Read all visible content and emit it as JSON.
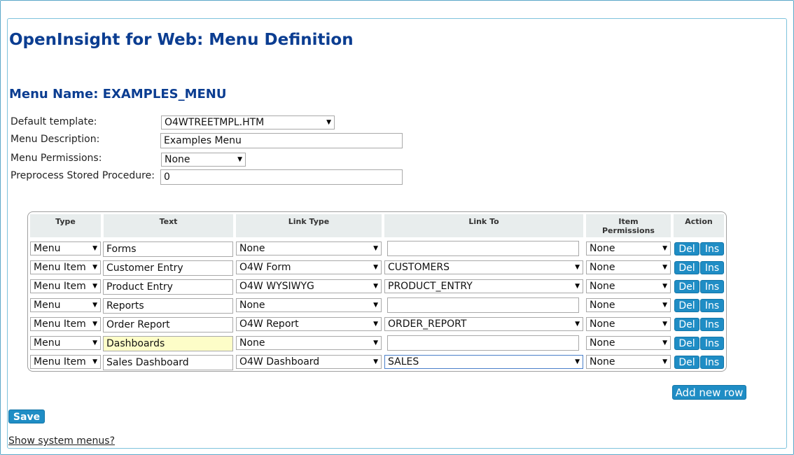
{
  "title": "OpenInsight for Web: Menu Definition",
  "menu_name": "Menu Name: EXAMPLES_MENU",
  "form": {
    "default_template_label": "Default template:",
    "default_template_value": "O4WTREETMPL.HTM",
    "description_label": "Menu Description:",
    "description_value": "Examples Menu",
    "permissions_label": "Menu Permissions:",
    "permissions_value": "None",
    "preprocess_label": "Preprocess Stored Procedure:",
    "preprocess_value": "0"
  },
  "table": {
    "headers": {
      "type": "Type",
      "text": "Text",
      "link_type": "Link Type",
      "link_to": "Link To",
      "item_permissions_1": "Item",
      "item_permissions_2": "Permissions",
      "action": "Action"
    },
    "rows": [
      {
        "type": "Menu",
        "text": "Forms",
        "link_type": "None",
        "link_to": "",
        "permissions": "None"
      },
      {
        "type": "Menu Item",
        "text": "Customer Entry",
        "link_type": "O4W Form",
        "link_to": "CUSTOMERS",
        "permissions": "None"
      },
      {
        "type": "Menu Item",
        "text": "Product Entry",
        "link_type": "O4W WYSIWYG",
        "link_to": "PRODUCT_ENTRY",
        "permissions": "None"
      },
      {
        "type": "Menu",
        "text": "Reports",
        "link_type": "None",
        "link_to": "",
        "permissions": "None"
      },
      {
        "type": "Menu Item",
        "text": "Order Report",
        "link_type": "O4W Report",
        "link_to": "ORDER_REPORT",
        "permissions": "None"
      },
      {
        "type": "Menu",
        "text": "Dashboards",
        "link_type": "None",
        "link_to": "",
        "permissions": "None"
      },
      {
        "type": "Menu Item",
        "text": "Sales Dashboard",
        "link_type": "O4W Dashboard",
        "link_to": "SALES",
        "permissions": "None"
      }
    ],
    "del_label": "Del",
    "ins_label": "Ins"
  },
  "add_row_label": "Add new row",
  "save_label": "Save",
  "show_system_label": "Show system menus?",
  "colors": {
    "title": "#0b3d91",
    "button": "#1f8dc5",
    "highlight_field": "#fdfdc8"
  }
}
